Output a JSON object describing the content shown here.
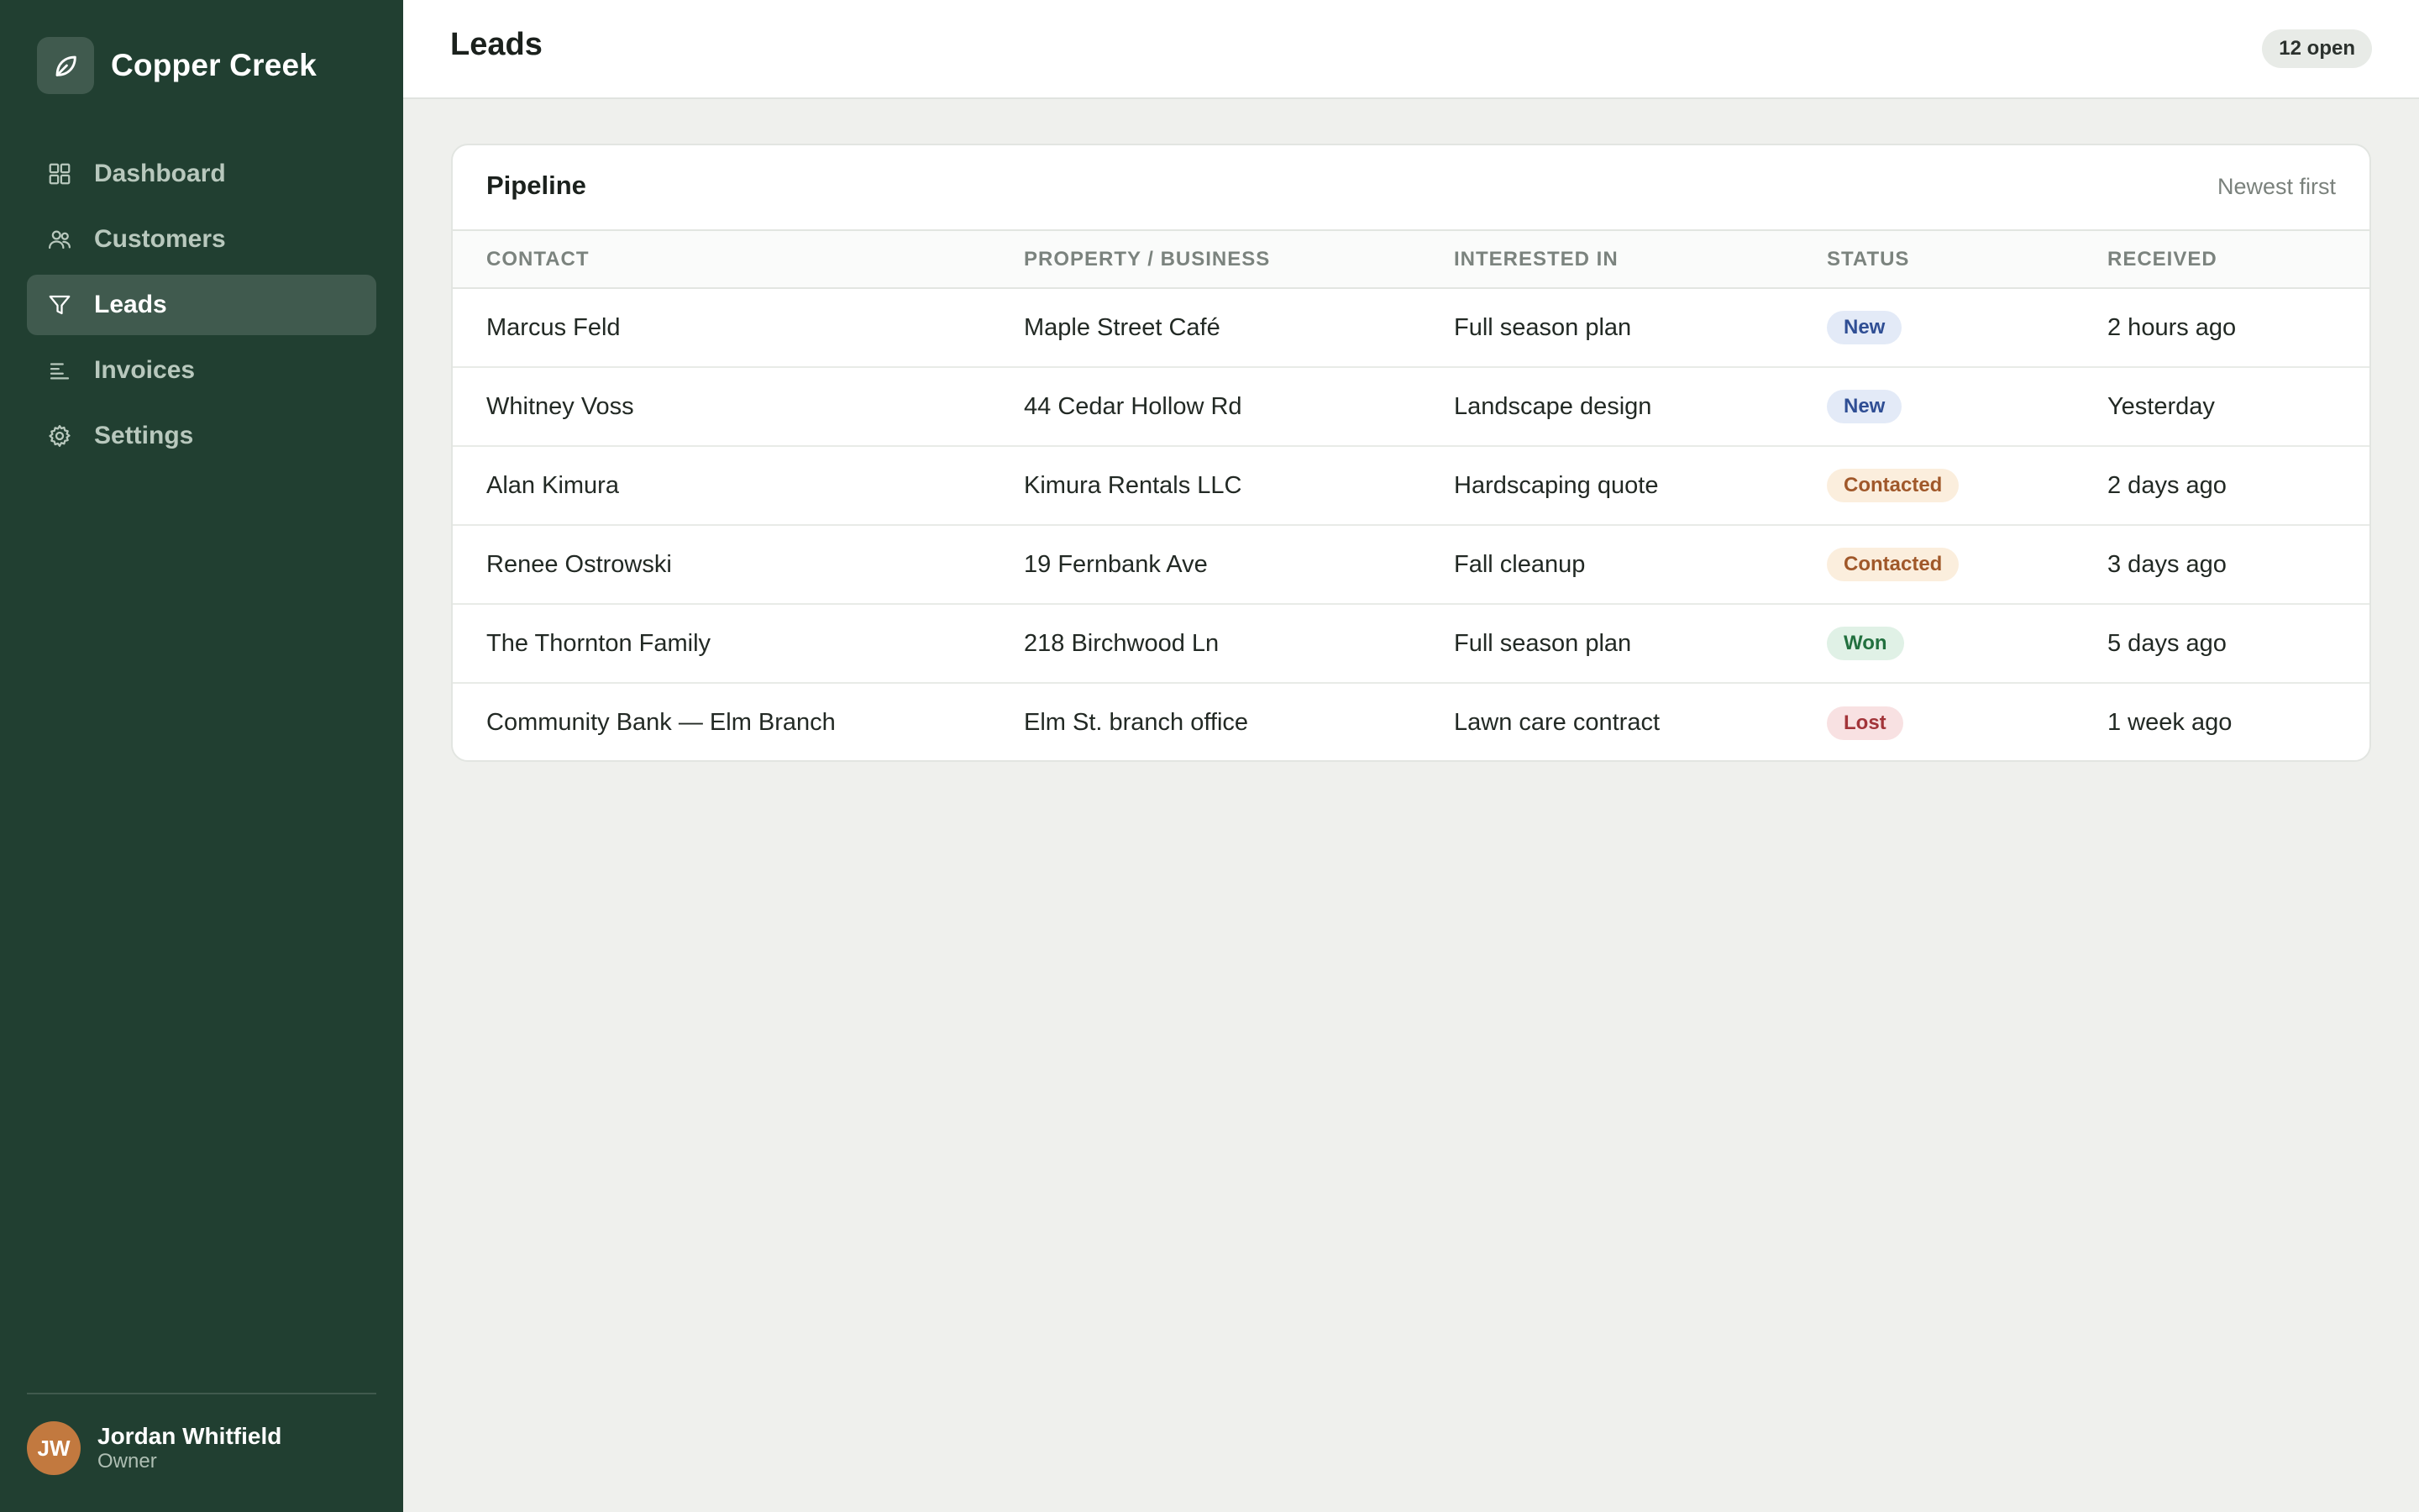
{
  "brand": {
    "name": "Copper Creek",
    "icon": "leaf-icon"
  },
  "sidebar": {
    "items": [
      {
        "label": "Dashboard",
        "icon": "grid-icon",
        "active": false
      },
      {
        "label": "Customers",
        "icon": "users-icon",
        "active": false
      },
      {
        "label": "Leads",
        "icon": "funnel-icon",
        "active": true
      },
      {
        "label": "Invoices",
        "icon": "lines-icon",
        "active": false
      },
      {
        "label": "Settings",
        "icon": "gear-icon",
        "active": false
      }
    ],
    "user": {
      "initials": "JW",
      "name": "Jordan Whitfield",
      "role": "Owner"
    }
  },
  "header": {
    "title": "Leads",
    "badge": "12 open"
  },
  "pipeline": {
    "title": "Pipeline",
    "sort_label": "Newest first",
    "columns": [
      "CONTACT",
      "PROPERTY / BUSINESS",
      "INTERESTED IN",
      "STATUS",
      "RECEIVED"
    ],
    "rows": [
      {
        "contact": "Marcus Feld",
        "property": "Maple Street Café",
        "interest": "Full season plan",
        "status": "New",
        "received": "2 hours ago"
      },
      {
        "contact": "Whitney Voss",
        "property": "44 Cedar Hollow Rd",
        "interest": "Landscape design",
        "status": "New",
        "received": "Yesterday"
      },
      {
        "contact": "Alan Kimura",
        "property": "Kimura Rentals LLC",
        "interest": "Hardscaping quote",
        "status": "Contacted",
        "received": "2 days ago"
      },
      {
        "contact": "Renee Ostrowski",
        "property": "19 Fernbank Ave",
        "interest": "Fall cleanup",
        "status": "Contacted",
        "received": "3 days ago"
      },
      {
        "contact": "The Thornton Family",
        "property": "218 Birchwood Ln",
        "interest": "Full season plan",
        "status": "Won",
        "received": "5 days ago"
      },
      {
        "contact": "Community Bank — Elm Branch",
        "property": "Elm St. branch office",
        "interest": "Lawn care contract",
        "status": "Lost",
        "received": "1 week ago"
      }
    ]
  },
  "colors": {
    "sidebar_bg": "#213f31",
    "avatar_bg": "#c2793f",
    "status_new": "#2f4e94",
    "status_contacted": "#a0582a",
    "status_won": "#22703f",
    "status_lost": "#a23439"
  }
}
